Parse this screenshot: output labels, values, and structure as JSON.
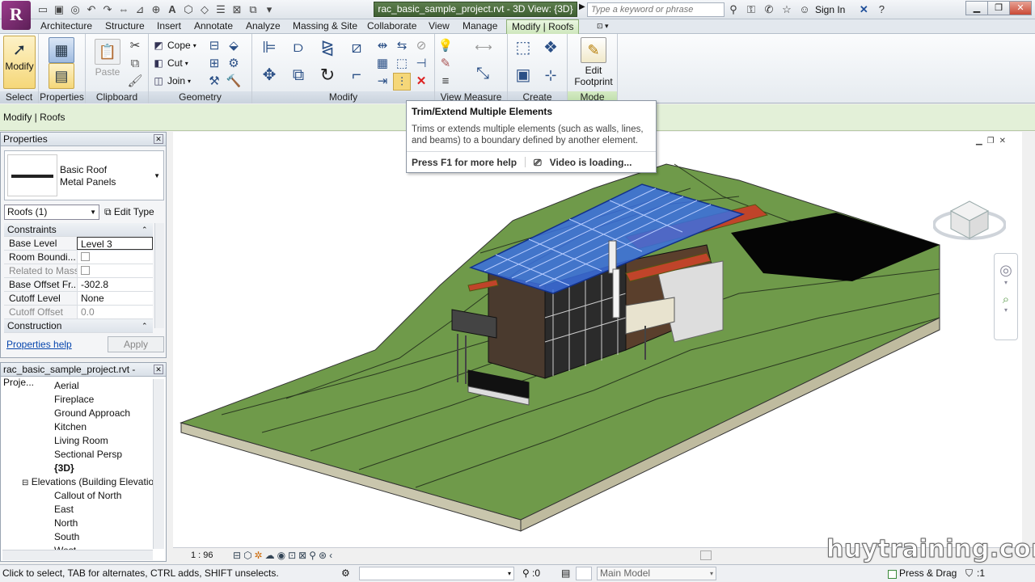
{
  "titlebar": {
    "app_letter": "R",
    "document_title": "rac_basic_sample_project.rvt - 3D View: {3D}",
    "search_placeholder": "Type a keyword or phrase",
    "sign_in": "Sign In"
  },
  "tabs": [
    "Architecture",
    "Structure",
    "Insert",
    "Annotate",
    "Analyze",
    "Massing & Site",
    "Collaborate",
    "View",
    "Manage",
    "Modify | Roofs"
  ],
  "ribbon": {
    "select": {
      "button": "Modify",
      "panel": "Select"
    },
    "properties": {
      "panel": "Properties"
    },
    "clipboard": {
      "paste": "Paste",
      "panel": "Clipboard"
    },
    "geometry": {
      "cope": "Cope",
      "cut": "Cut",
      "join": "Join",
      "panel": "Geometry"
    },
    "modify": {
      "panel": "Modify"
    },
    "view_measure": {
      "panel": "View Measure"
    },
    "create": {
      "panel": "Create"
    },
    "mode": {
      "button_line1": "Edit",
      "button_line2": "Footprint",
      "panel": "Mode"
    }
  },
  "context_bar": "Modify | Roofs",
  "tooltip": {
    "title": "Trim/Extend Multiple Elements",
    "body": "Trims or extends multiple elements (such as walls, lines, and beams) to a boundary defined by another element.",
    "help": "Press F1 for more help",
    "video": "Video is loading..."
  },
  "properties": {
    "title": "Properties",
    "type_line1": "Basic Roof",
    "type_line2": "Metal Panels",
    "instance_selector": "Roofs (1)",
    "edit_type": "Edit Type",
    "groups": {
      "constraints": "Constraints",
      "construction": "Construction"
    },
    "rows": {
      "base_level": {
        "label": "Base Level",
        "value": "Level 3"
      },
      "room_bounding": {
        "label": "Room Boundi..."
      },
      "related_to_mass": {
        "label": "Related to Mass"
      },
      "base_offset": {
        "label": "Base Offset Fr...",
        "value": "-302.8"
      },
      "cutoff_level": {
        "label": "Cutoff Level",
        "value": "None"
      },
      "cutoff_offset": {
        "label": "Cutoff Offset",
        "value": "0.0"
      }
    },
    "help_link": "Properties help",
    "apply": "Apply"
  },
  "browser": {
    "title": "rac_basic_sample_project.rvt - Proje...",
    "items": [
      "Aerial",
      "Fireplace",
      "Ground Approach",
      "Kitchen",
      "Living Room",
      "Sectional Persp",
      "{3D}"
    ],
    "elevations_group": "Elevations (Building Elevatio",
    "elevation_items": [
      "Callout of North",
      "East",
      "North",
      "South",
      "West"
    ]
  },
  "view_control": {
    "scale": "1 : 96"
  },
  "status": {
    "message": "Click to select, TAB for alternates, CTRL adds, SHIFT unselects.",
    "worksets_count": ":0",
    "model": "Main Model",
    "press_drag": "Press & Drag",
    "filter_count": ":1"
  },
  "watermark": "huytraining.com",
  "colors": {
    "terrain": "#6f9a4a",
    "roof_selected": "#3b6fe0",
    "accent_red": "#c0442a",
    "context_tab": "#cde6bb"
  }
}
